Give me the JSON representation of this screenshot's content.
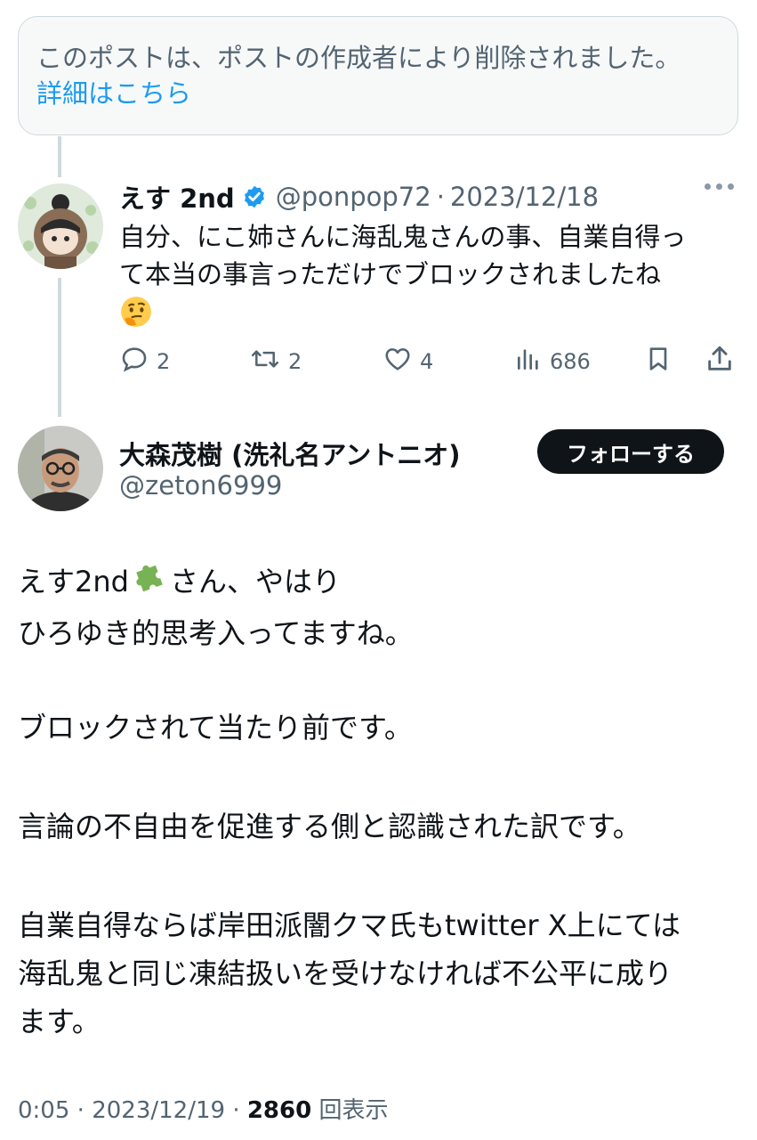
{
  "deleted_notice": {
    "text": "このポストは、ポストの作成者により削除されました。",
    "link": "詳細はこちら"
  },
  "reply": {
    "name": "えす 2nd",
    "handle": "@ponpop72",
    "separator": "·",
    "date": "2023/12/18",
    "line1": "自分、にこ姉さんに海乱鬼さんの事、自業自得っ",
    "line2": "て本当の事言っただけでブロックされましたね",
    "replies": "2",
    "reposts": "2",
    "likes": "4",
    "views": "686"
  },
  "main_post": {
    "name": "大森茂樹 (洗礼名アントニオ)",
    "handle": "@zeton6999",
    "follow_label": "フォローする",
    "line1a": "えす2nd",
    "line1b": "さん、やはり",
    "line2": "ひろゆき的思考入ってますね。",
    "line3": "ブロックされて当たり前です。",
    "line4": "言論の不自由を促進する側と認識された訳です。",
    "line5": "自業自得ならば岸田派闇クマ氏もtwitter X上にては",
    "line6": "海乱鬼と同じ凍結扱いを受けなければ不公平に成り",
    "line7": "ます。"
  },
  "footer": {
    "time": "0:05",
    "sep1": "·",
    "date": "2023/12/19",
    "sep2": "·",
    "views": "2860",
    "views_label": "回表示"
  }
}
